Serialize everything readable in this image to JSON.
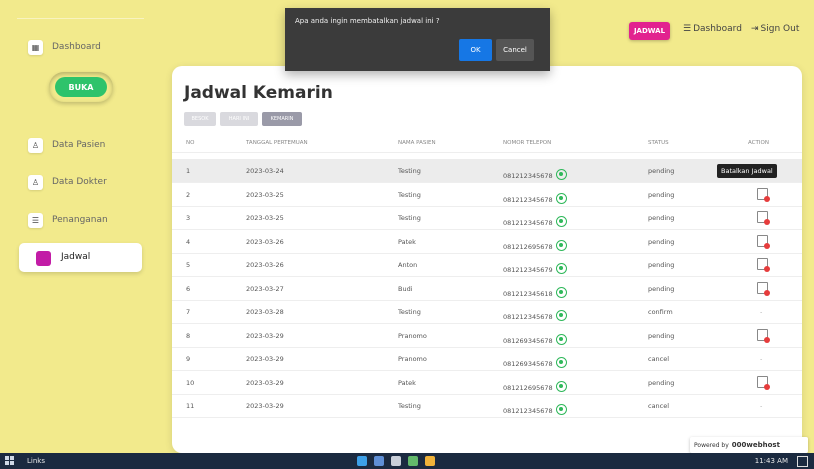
{
  "sidebar": {
    "items": [
      {
        "label": "Dashboard",
        "icon": "dashboard-icon",
        "glyph": "▦"
      },
      {
        "label": "Data Pasien",
        "icon": "users-icon",
        "glyph": "♙"
      },
      {
        "label": "Data Dokter",
        "icon": "doctor-icon",
        "glyph": "♙"
      },
      {
        "label": "Penanganan",
        "icon": "list-icon",
        "glyph": "☰"
      }
    ],
    "active": {
      "label": "Jadwal",
      "icon": "calendar-icon"
    },
    "toggle_label": "BUKA"
  },
  "topbar": {
    "jadwal_label": "JADWAL",
    "dashboard_label": "Dashboard",
    "signout_label": "Sign Out"
  },
  "modal": {
    "message": "Apa anda ingin membatalkan jadwal ini ?",
    "ok_label": "OK",
    "cancel_label": "Cancel"
  },
  "main": {
    "title": "Jadwal Kemarin",
    "filters": [
      "BESOK",
      "HARI INI",
      "KEMARIN"
    ],
    "columns": [
      "NO",
      "TANGGAL PERTEMUAN",
      "NAMA PASIEN",
      "NOMOR TELEPON",
      "STATUS",
      "ACTION"
    ],
    "tooltip": "Batalkan Jadwal",
    "rows": [
      {
        "no": "1",
        "date": "2023-03-24",
        "name": "Testing",
        "phone": "081212345678",
        "status": "pending"
      },
      {
        "no": "2",
        "date": "2023-03-25",
        "name": "Testing",
        "phone": "081212345678",
        "status": "pending"
      },
      {
        "no": "3",
        "date": "2023-03-25",
        "name": "Testing",
        "phone": "081212345678",
        "status": "pending"
      },
      {
        "no": "4",
        "date": "2023-03-26",
        "name": "Patek",
        "phone": "081212695678",
        "status": "pending"
      },
      {
        "no": "5",
        "date": "2023-03-26",
        "name": "Anton",
        "phone": "081212345679",
        "status": "pending"
      },
      {
        "no": "6",
        "date": "2023-03-27",
        "name": "Budi",
        "phone": "081212345618",
        "status": "pending"
      },
      {
        "no": "7",
        "date": "2023-03-28",
        "name": "Testing",
        "phone": "081212345678",
        "status": "confirm"
      },
      {
        "no": "8",
        "date": "2023-03-29",
        "name": "Pranomo",
        "phone": "081269345678",
        "status": "pending"
      },
      {
        "no": "9",
        "date": "2023-03-29",
        "name": "Pranomo",
        "phone": "081269345678",
        "status": "cancel"
      },
      {
        "no": "10",
        "date": "2023-03-29",
        "name": "Patek",
        "phone": "081212695678",
        "status": "pending"
      },
      {
        "no": "11",
        "date": "2023-03-29",
        "name": "Testing",
        "phone": "081212345678",
        "status": "cancel"
      }
    ]
  },
  "badge": {
    "prefix": "Powered by",
    "brand": "000webhost"
  },
  "taskbar": {
    "links_label": "Links",
    "time": "11:43 AM"
  },
  "colors": {
    "background": "#f2ea8c",
    "accent": "#e2228f",
    "active_icon": "#c21ca6",
    "toggle": "#2ec36b",
    "ok_button": "#1677e5"
  }
}
